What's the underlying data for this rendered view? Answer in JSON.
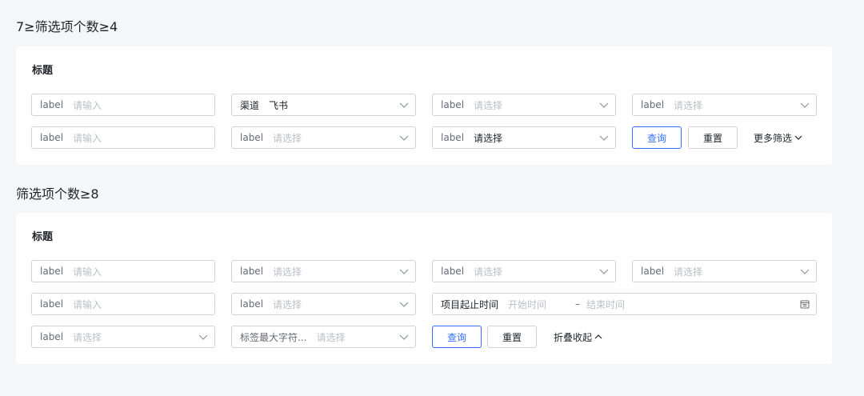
{
  "section1": {
    "heading": "7≥筛选项个数≥4",
    "card_title": "标题",
    "fields": [
      {
        "label": "label",
        "placeholder": "请输入"
      },
      {
        "label": "渠道",
        "value": "飞书"
      },
      {
        "label": "label",
        "placeholder": "请选择"
      },
      {
        "label": "label",
        "placeholder": "请选择"
      },
      {
        "label": "label",
        "placeholder": "请输入"
      },
      {
        "label": "label",
        "placeholder": "请选择"
      },
      {
        "label": "label",
        "value": "请选择"
      }
    ],
    "query_label": "查询",
    "reset_label": "重置",
    "more_label": "更多筛选"
  },
  "section2": {
    "heading": "筛选项个数≥8",
    "card_title": "标题",
    "fields": [
      {
        "label": "label",
        "placeholder": "请输入"
      },
      {
        "label": "label",
        "placeholder": "请选择"
      },
      {
        "label": "label",
        "placeholder": "请选择"
      },
      {
        "label": "label",
        "placeholder": "请选择"
      },
      {
        "label": "label",
        "placeholder": "请输入"
      },
      {
        "label": "label",
        "placeholder": "请选择"
      },
      {
        "label": "label",
        "placeholder": "请选择"
      },
      {
        "label": "标签最大字符...",
        "placeholder": "请选择"
      }
    ],
    "date_range": {
      "label": "项目起止时间",
      "start_placeholder": "开始时间",
      "separator": "–",
      "end_placeholder": "结束时间"
    },
    "query_label": "查询",
    "reset_label": "重置",
    "collapse_label": "折叠收起"
  },
  "colors": {
    "background": "#f5f6f8",
    "card": "#ffffff",
    "primary": "#3370ff",
    "border": "#d0d3d6",
    "placeholder": "#bbbfc4",
    "label": "#646a73"
  }
}
